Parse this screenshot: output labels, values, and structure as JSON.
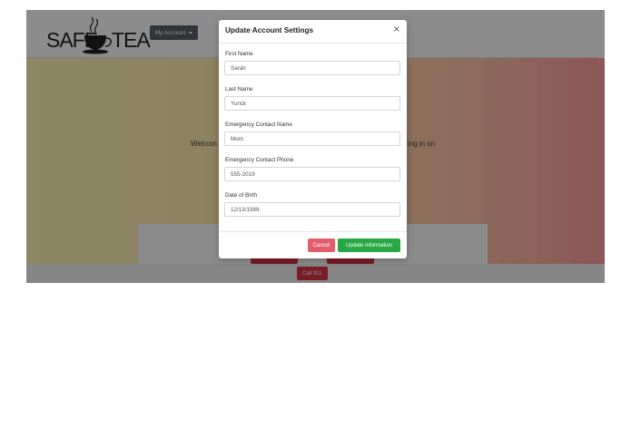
{
  "brand": {
    "left": "SAFE",
    "right": "TEA"
  },
  "nav": {
    "account_label": "My Account"
  },
  "hero": {
    "welcome_left": "Welcom",
    "welcome_right": "ing in on"
  },
  "footer": {
    "call_label": "Call 911"
  },
  "modal": {
    "title": "Update Account Settings",
    "close_label": "×",
    "fields": [
      {
        "label": "First Name",
        "value": "Sarah"
      },
      {
        "label": "Last Name",
        "value": "Yurick"
      },
      {
        "label": "Emergency Contact Name",
        "value": "Mom"
      },
      {
        "label": "Emergency Contact Phone",
        "value": "555-2019"
      },
      {
        "label": "Date of Birth",
        "value": "12/13/1989"
      }
    ],
    "cancel_label": "Cancel",
    "update_label": "Update Information"
  },
  "colors": {
    "primary_button": "#5a6268",
    "danger": "#dc3545",
    "success": "#28a745"
  }
}
